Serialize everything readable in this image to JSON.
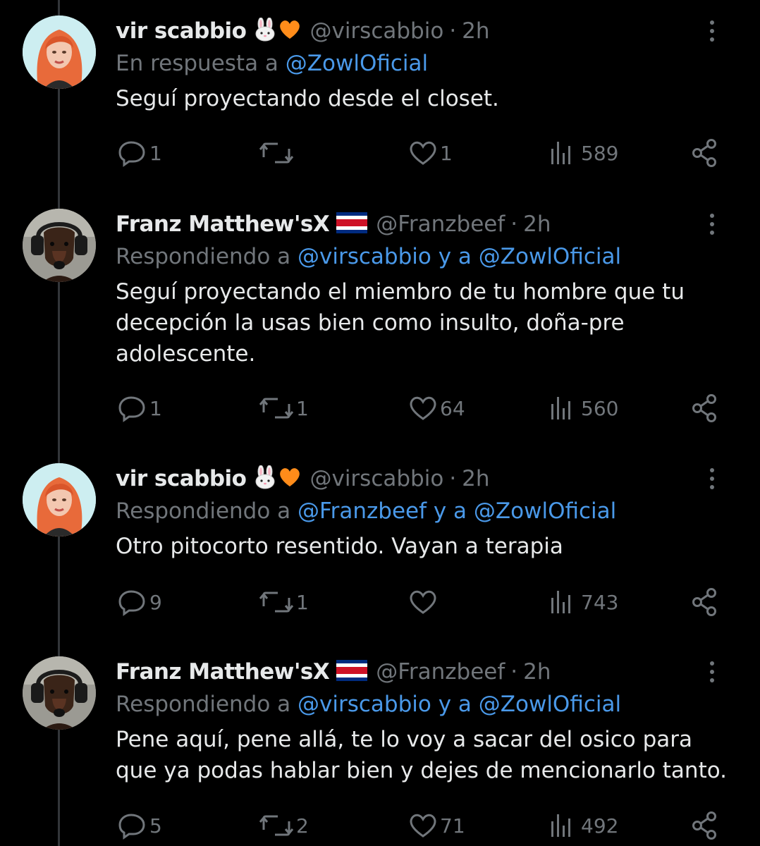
{
  "tweets": [
    {
      "name": "vir scabbio",
      "emojis": [
        "rabbit-emoji",
        "orange-heart-emoji"
      ],
      "handle": "@virscabbio",
      "dot": "·",
      "time": "2h",
      "reply_prefix": "En respuesta a ",
      "reply_mentions": "@ZowlOficial",
      "text": "Seguí proyectando desde el closet.",
      "replies": "1",
      "retweets": "",
      "likes": "1",
      "views": "589",
      "avatar": "red-haired-woman-avatar"
    },
    {
      "name": "Franz Matthew'sX",
      "emojis": [
        "costa-rica-flag-emoji"
      ],
      "handle": "@Franzbeef",
      "dot": "·",
      "time": "2h",
      "reply_prefix": "Respondiendo a ",
      "reply_mentions": "@virscabbio y a @ZowlOficial",
      "text": "Seguí proyectando el miembro de tu hombre que tu decepción la usas bien como insulto, doña-pre adolescente.",
      "replies": "1",
      "retweets": "1",
      "likes": "64",
      "views": "560",
      "avatar": "dachshund-with-headphones-avatar"
    },
    {
      "name": "vir scabbio",
      "emojis": [
        "rabbit-emoji",
        "orange-heart-emoji"
      ],
      "handle": "@virscabbio",
      "dot": "·",
      "time": "2h",
      "reply_prefix": "Respondiendo a ",
      "reply_mentions": "@Franzbeef y a @ZowlOficial",
      "text": "Otro pitocorto resentido. Vayan a terapia",
      "replies": "9",
      "retweets": "1",
      "likes": "",
      "views": "743",
      "avatar": "red-haired-woman-avatar"
    },
    {
      "name": "Franz Matthew'sX",
      "emojis": [
        "costa-rica-flag-emoji"
      ],
      "handle": "@Franzbeef",
      "dot": "·",
      "time": "2h",
      "reply_prefix": "Respondiendo a ",
      "reply_mentions": "@virscabbio y a @ZowlOficial",
      "text": "Pene aquí, pene allá, te lo voy a sacar del osico para que ya podas hablar bien y dejes de mencionarlo tanto.",
      "replies": "5",
      "retweets": "2",
      "likes": "71",
      "views": "492",
      "avatar": "dachshund-with-headphones-avatar"
    }
  ],
  "colors": {
    "background": "#000000",
    "text": "#e7e9ea",
    "muted": "#71767b",
    "link": "#4a99e9",
    "thread_line": "#333639"
  }
}
